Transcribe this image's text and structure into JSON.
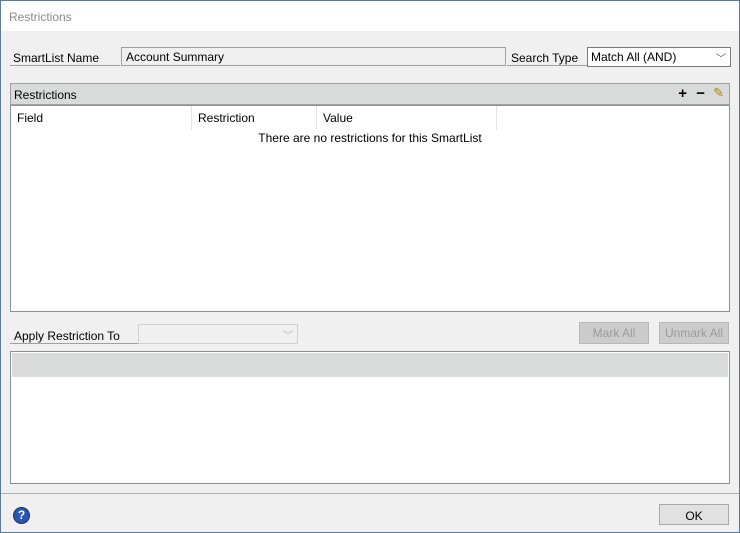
{
  "window": {
    "title": "Restrictions"
  },
  "smartlist": {
    "label": "SmartList Name",
    "value": "Account Summary"
  },
  "search_type": {
    "label": "Search Type",
    "value": "Match All (AND)"
  },
  "restrictions": {
    "header": "Restrictions",
    "columns": [
      "Field",
      "Restriction",
      "Value"
    ],
    "empty_message": "There are no restrictions for this SmartList"
  },
  "apply": {
    "label": "Apply Restriction To",
    "value": ""
  },
  "buttons": {
    "mark_all": "Mark All",
    "unmark_all": "Unmark All",
    "ok": "OK"
  },
  "icons": {
    "add": "plus-icon",
    "remove": "minus-icon",
    "edit": "pencil-icon",
    "help": "help-icon"
  }
}
